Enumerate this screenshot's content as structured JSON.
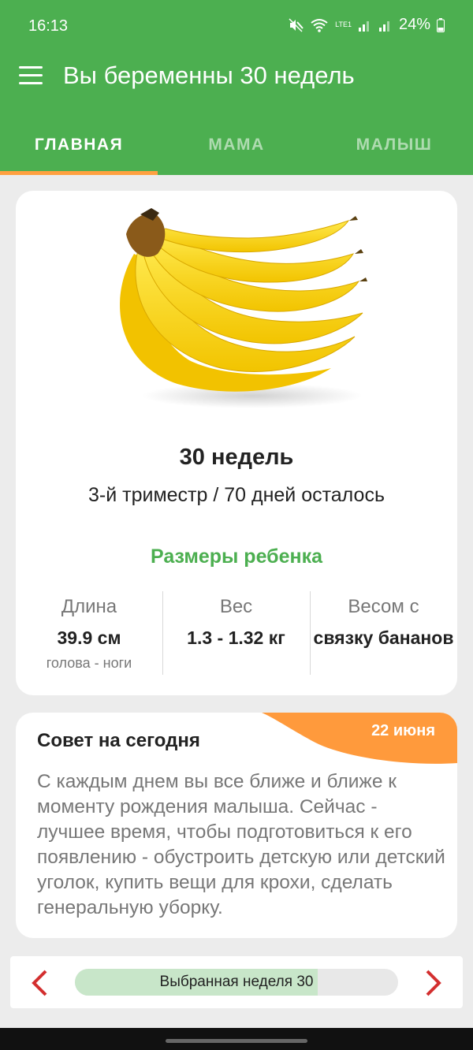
{
  "status": {
    "time": "16:13",
    "network": "LTE1",
    "battery": "24%"
  },
  "toolbar": {
    "title": "Вы беременны 30 недель"
  },
  "tabs": [
    {
      "label": "ГЛАВНАЯ",
      "active": true
    },
    {
      "label": "МАМА",
      "active": false
    },
    {
      "label": "МАЛЫШ",
      "active": false
    }
  ],
  "main": {
    "week_title": "30 недель",
    "trimester": "3-й триместр / 70 дней осталось",
    "sizes_title": "Размеры ребенка",
    "stats": [
      {
        "label": "Длина",
        "value": "39.9 см",
        "note": "голова - ноги"
      },
      {
        "label": "Вес",
        "value": "1.3 - 1.32 кг",
        "note": ""
      },
      {
        "label": "Весом с",
        "value": "связку бананов",
        "note": ""
      }
    ]
  },
  "tip": {
    "title": "Совет на сегодня",
    "date": "22 июня",
    "text": "С каждым днем вы все ближе и ближе к моменту рождения малыша. Сейчас - лучшее время, чтобы подготовиться к его появлению - обустроить детскую или детский уголок, купить вещи для крохи, сделать генеральную уборку."
  },
  "week_nav": {
    "label": "Выбранная неделя 30",
    "progress": 0.75
  },
  "colors": {
    "primary": "#4caf50",
    "accent": "#ffa040",
    "badge": "#ff9a3c",
    "arrow": "#d32f2f"
  }
}
